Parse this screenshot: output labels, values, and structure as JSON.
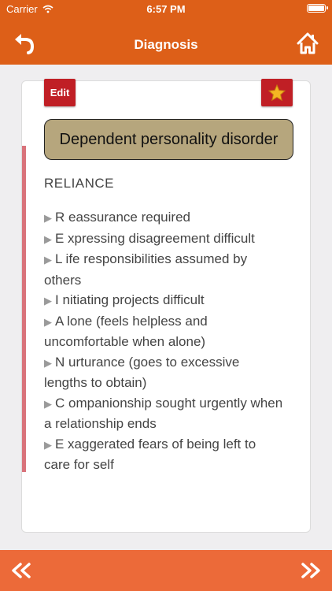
{
  "status": {
    "carrier": "Carrier",
    "time": "6:57 PM"
  },
  "nav": {
    "title": "Diagnosis",
    "back_icon": "back-arrow-icon",
    "home_icon": "home-icon"
  },
  "card": {
    "edit_label": "Edit",
    "favorite_icon": "star-icon",
    "title": "Dependent personality disorder",
    "heading": "RELIANCE",
    "items": [
      "R eassurance required",
      "E xpressing disagreement difficult",
      "L ife responsibilities assumed by others",
      "I nitiating projects difficult",
      "A lone (feels helpless and uncomfortable when alone)",
      "N urturance (goes to excessive lengths to obtain)",
      "C ompanionship sought urgently when a relationship ends",
      "E xaggerated fears of being left to care for self"
    ]
  },
  "footer": {
    "prev_icon": "double-chevron-left-icon",
    "next_icon": "double-chevron-right-icon"
  },
  "colors": {
    "header": "#dd5f18",
    "footer": "#ec6a39",
    "accent": "#c01f25",
    "title_box": "#b6a67d",
    "side_bar": "#d9737b"
  }
}
